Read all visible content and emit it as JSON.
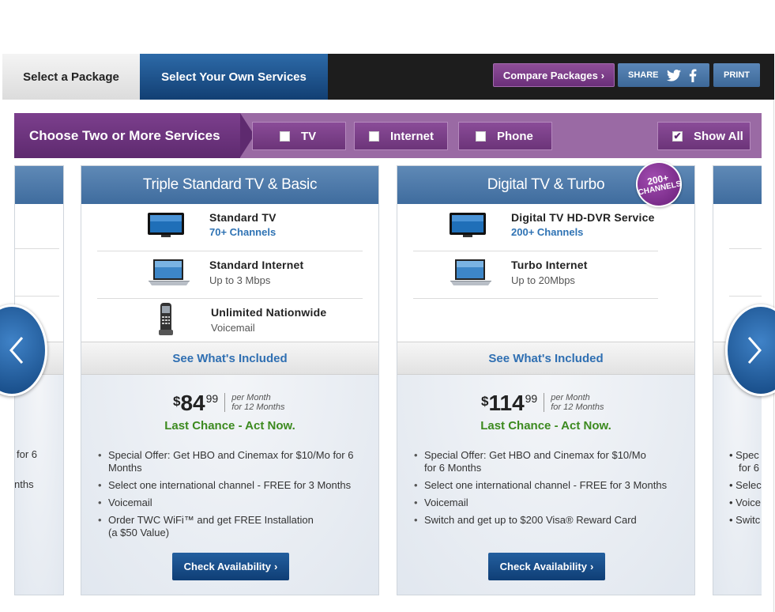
{
  "tabs": {
    "select_package": "Select a Package",
    "select_own": "Select Your Own Services"
  },
  "toolbar": {
    "compare_label": "Compare Packages",
    "share_label": "SHARE",
    "print_label": "PRINT"
  },
  "filter": {
    "title": "Choose Two or More Services",
    "options": [
      {
        "label": "TV",
        "checked": false
      },
      {
        "label": "Internet",
        "checked": false
      },
      {
        "label": "Phone",
        "checked": false
      },
      {
        "label": "Show All",
        "checked": true
      }
    ]
  },
  "cards": [
    {
      "title": "Triple Standard TV & Basic",
      "services": [
        {
          "name": "Standard TV",
          "sub": "70+ Channels",
          "icon": "tv-icon"
        },
        {
          "name": "Standard Internet",
          "sub": "Up to 3 Mbps",
          "icon": "laptop-icon"
        },
        {
          "name": "Unlimited Nationwide",
          "sub": "Voicemail",
          "icon": "phone-icon"
        }
      ],
      "see_included": "See What's Included",
      "price": {
        "currency": "$",
        "dollars": "84",
        "cents": "99",
        "per1": "per Month",
        "per2": "for 12 Months"
      },
      "offer": "Last Chance - Act Now.",
      "bullets": [
        "Special Offer: Get HBO and Cinemax for $10/Mo for 6 Months",
        "Select one international channel - FREE for 3 Months",
        "Voicemail",
        "Order TWC WiFi™ and get FREE Installation (a $50 Value)"
      ],
      "cta": "Check Availability"
    },
    {
      "title": "Digital TV & Turbo",
      "services": [
        {
          "name": "Digital TV HD-DVR Service",
          "sub": "200+ Channels",
          "icon": "tv-icon"
        },
        {
          "name": "Turbo Internet",
          "sub": "Up to 20Mbps",
          "icon": "laptop-icon"
        }
      ],
      "see_included": "See What's Included",
      "price": {
        "currency": "$",
        "dollars": "114",
        "cents": "99",
        "per1": "per Month",
        "per2": "for 12 Months"
      },
      "offer": "Last Chance - Act Now.",
      "bullets": [
        "Special Offer: Get HBO and Cinemax for $10/Mo for 6 Months",
        "Select one international channel - FREE for 3 Months",
        "Voicemail",
        "Switch and get up to $200 Visa® Reward Card"
      ],
      "cta": "Check Availability",
      "badge": {
        "line1": "200+",
        "line2": "CHANNELS"
      }
    }
  ],
  "left_partial": {
    "bullet1": "for 6",
    "bullet2": "nths"
  },
  "right_partial": {
    "bullets": [
      "Spec",
      "for 6",
      "Selec",
      "Voice",
      "Switc"
    ]
  }
}
